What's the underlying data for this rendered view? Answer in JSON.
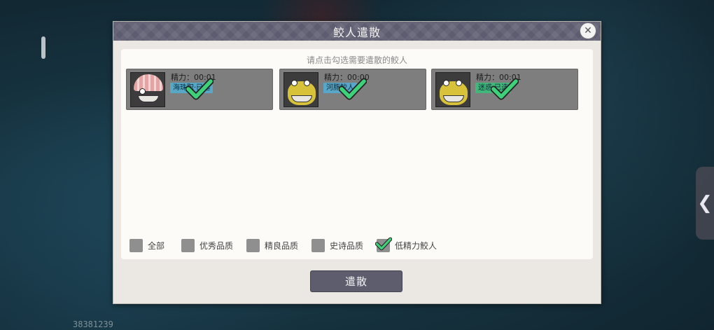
{
  "dialog": {
    "title": "鲛人遣散",
    "hint": "请点击勾选需要遣散的鲛人",
    "action_label": "遣散"
  },
  "cards": [
    {
      "energy": "精力：00:01",
      "tag": "海珠职·已选",
      "tag_color": "#58a7c6",
      "portrait": "shell-fish",
      "selected": true
    },
    {
      "energy": "精力：00:00",
      "tag": "河豚鲛人",
      "tag_color": "#5aa6c8",
      "portrait": "yellow-fish",
      "selected": true
    },
    {
      "energy": "精力：00:01",
      "tag": "迷惑·已选",
      "tag_color": "#43b77a",
      "portrait": "yellow-fish",
      "selected": true
    }
  ],
  "filters": [
    {
      "label": "全部",
      "checked": false
    },
    {
      "label": "优秀品质",
      "checked": false
    },
    {
      "label": "精良品质",
      "checked": false
    },
    {
      "label": "史诗品质",
      "checked": false
    },
    {
      "label": "低精力鲛人",
      "checked": true
    }
  ],
  "hud": {
    "player_id": "38381239"
  },
  "colors": {
    "header": "#5d5c70",
    "check": "#3fd07a",
    "button": "#5e5d6e"
  }
}
